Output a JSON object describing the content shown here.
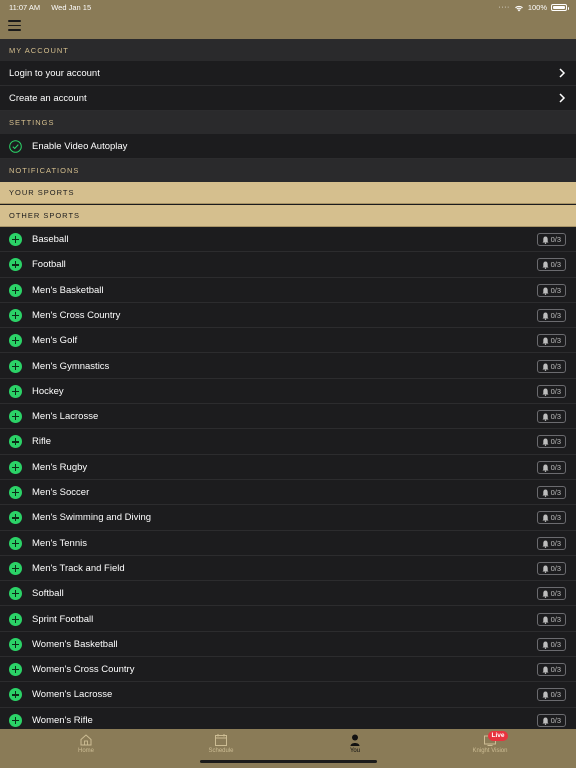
{
  "status_bar": {
    "time": "11:07 AM",
    "date": "Wed Jan 15",
    "battery": "100%",
    "battery_level": 1.0
  },
  "icons": {
    "menu": "hamburger-icon",
    "chevron": "chevron-right-icon",
    "check": "check-circle-icon",
    "add": "add-circle-icon",
    "bell": "bell-icon"
  },
  "colors": {
    "header": "#8a7b57",
    "accent": "#d5bf8e",
    "add": "#2bd267",
    "live": "#e8333f",
    "background": "#1c1c1e"
  },
  "my_account": {
    "title": "MY ACCOUNT",
    "login": "Login to your account",
    "create": "Create an account"
  },
  "settings": {
    "title": "SETTINGS",
    "autoplay": "Enable Video Autoplay",
    "autoplay_enabled": true
  },
  "notifications": {
    "title": "NOTIFICATIONS",
    "your_sports": "YOUR SPORTS",
    "other_sports": "OTHER SPORTS"
  },
  "sports": [
    {
      "name": "Baseball",
      "count": "0/3"
    },
    {
      "name": "Football",
      "count": "0/3"
    },
    {
      "name": "Men's Basketball",
      "count": "0/3"
    },
    {
      "name": "Men's Cross Country",
      "count": "0/3"
    },
    {
      "name": "Men's Golf",
      "count": "0/3"
    },
    {
      "name": "Men's Gymnastics",
      "count": "0/3"
    },
    {
      "name": "Hockey",
      "count": "0/3"
    },
    {
      "name": "Men's Lacrosse",
      "count": "0/3"
    },
    {
      "name": "Rifle",
      "count": "0/3"
    },
    {
      "name": "Men's Rugby",
      "count": "0/3"
    },
    {
      "name": "Men's Soccer",
      "count": "0/3"
    },
    {
      "name": "Men's Swimming and Diving",
      "count": "0/3"
    },
    {
      "name": "Men's Tennis",
      "count": "0/3"
    },
    {
      "name": "Men's Track and Field",
      "count": "0/3"
    },
    {
      "name": "Softball",
      "count": "0/3"
    },
    {
      "name": "Sprint Football",
      "count": "0/3"
    },
    {
      "name": "Women's Basketball",
      "count": "0/3"
    },
    {
      "name": "Women's Cross Country",
      "count": "0/3"
    },
    {
      "name": "Women's Lacrosse",
      "count": "0/3"
    },
    {
      "name": "Women's Rifle",
      "count": "0/3"
    }
  ],
  "tabs": [
    {
      "label": "Home",
      "icon": "home-icon"
    },
    {
      "label": "Schedule",
      "icon": "calendar-icon"
    },
    {
      "label": "You",
      "icon": "person-icon",
      "active": true
    },
    {
      "label": "Knight Vision",
      "icon": "tv-icon"
    }
  ],
  "live_badge": "Live"
}
